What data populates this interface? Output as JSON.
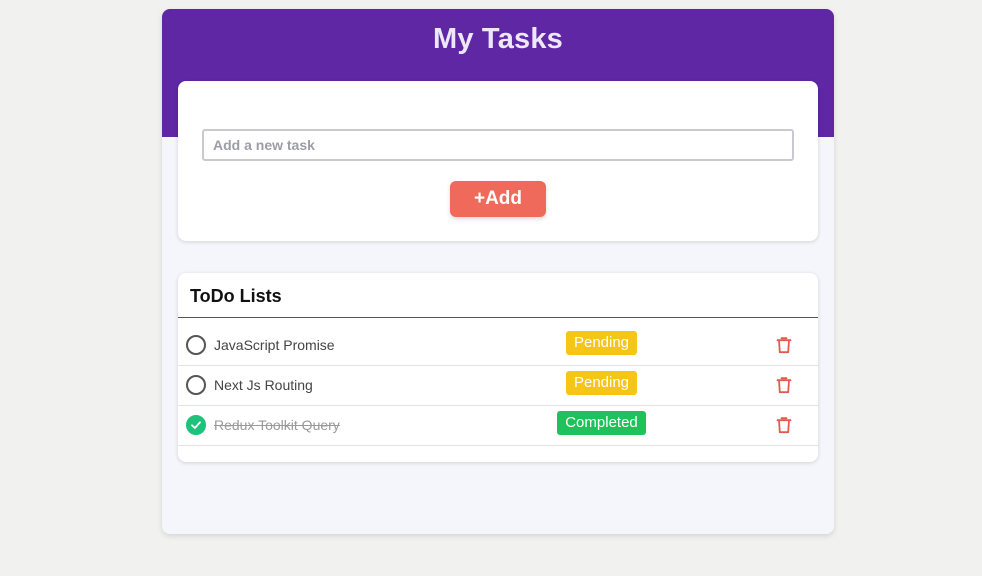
{
  "header": {
    "title": "My Tasks"
  },
  "add_form": {
    "placeholder": "Add a new task",
    "value": "",
    "add_label": "+Add"
  },
  "list": {
    "heading": "ToDo Lists",
    "items": [
      {
        "text": "JavaScript Promise",
        "status": "Pending",
        "completed": false
      },
      {
        "text": "Next Js Routing",
        "status": "Pending",
        "completed": false
      },
      {
        "text": "Redux Toolkit Query",
        "status": "Completed",
        "completed": true
      }
    ]
  },
  "colors": {
    "header": "#5f27a4",
    "add_button": "#ef6a5b",
    "pending": "#f5c518",
    "completed": "#1fc25a",
    "check_done": "#1fc27a",
    "trash": "#e05a4e"
  },
  "icons": {
    "check": "check-circle-icon",
    "delete": "trash-icon"
  }
}
